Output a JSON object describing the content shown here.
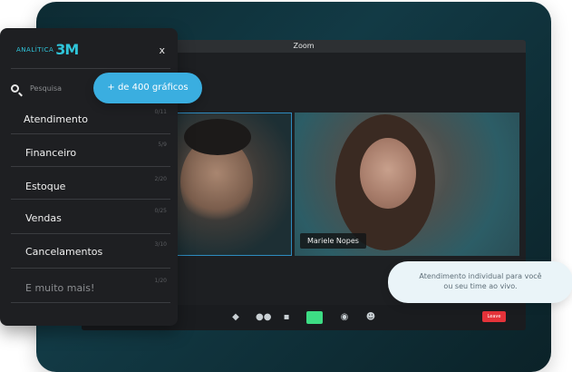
{
  "window": {
    "title": "Zoom"
  },
  "logo": {
    "text": "ANALÍTICA",
    "mark": "3M"
  },
  "panel": {
    "close_label": "x",
    "search_placeholder": "Pesquisa",
    "items": [
      {
        "label": "Atendimento",
        "count": "0/11"
      },
      {
        "label": "Financeiro",
        "count": "5/9"
      },
      {
        "label": "Estoque",
        "count": "2/20"
      },
      {
        "label": "Vendas",
        "count": "0/25"
      },
      {
        "label": "Cancelamentos",
        "count": "3/10"
      },
      {
        "label": "E muito mais!",
        "count": "1/20"
      }
    ]
  },
  "badge": {
    "label": "+ de 400 gráficos"
  },
  "video": {
    "participant_name": "Mariele Nopes"
  },
  "toolbar": {
    "leave_label": "Leave"
  },
  "bubble": {
    "line1": "Atendimento individual para você",
    "line2": "ou seu time ao vivo."
  }
}
